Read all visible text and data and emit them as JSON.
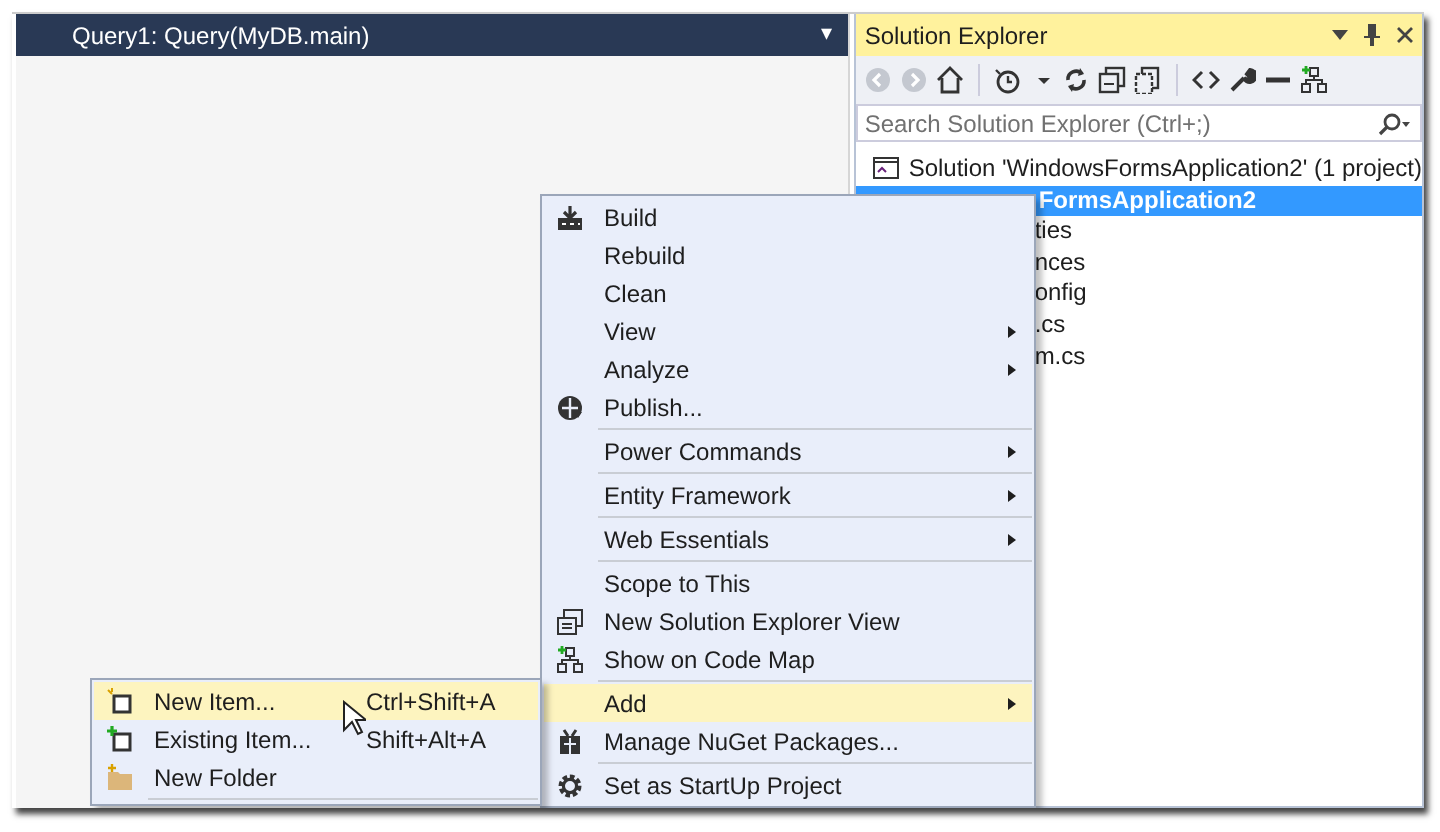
{
  "document_tab": {
    "title": "Query1: Query(MyDB.main)",
    "dropdown": "▾"
  },
  "solution_explorer": {
    "title": "Solution Explorer",
    "search": {
      "placeholder": "Search Solution Explorer (Ctrl+;)"
    },
    "tree": [
      {
        "label": "Solution 'WindowsFormsApplication2' (1 project)",
        "selected": false,
        "children": [
          {
            "label": "FormsApplication2",
            "selected": true,
            "children": [
              {
                "label": "ties",
                "selected": false
              },
              {
                "label": "nces",
                "selected": false
              },
              {
                "label": "onfig",
                "selected": false
              },
              {
                "label": ".cs",
                "selected": false
              },
              {
                "label": "m.cs",
                "selected": false
              }
            ]
          }
        ]
      }
    ]
  },
  "context_menu": {
    "items": [
      {
        "kind": "item",
        "label": "Build",
        "submenu": false,
        "selected": false
      },
      {
        "kind": "item",
        "label": "Rebuild",
        "submenu": false,
        "selected": false
      },
      {
        "kind": "item",
        "label": "Clean",
        "submenu": false,
        "selected": false
      },
      {
        "kind": "item",
        "label": "View",
        "submenu": true,
        "selected": false
      },
      {
        "kind": "item",
        "label": "Analyze",
        "submenu": true,
        "selected": false
      },
      {
        "kind": "item",
        "label": "Publish...",
        "submenu": false,
        "selected": false
      },
      {
        "kind": "separator"
      },
      {
        "kind": "item",
        "label": "Power Commands",
        "submenu": true,
        "selected": false
      },
      {
        "kind": "separator"
      },
      {
        "kind": "item",
        "label": "Entity Framework",
        "submenu": true,
        "selected": false
      },
      {
        "kind": "separator"
      },
      {
        "kind": "item",
        "label": "Web Essentials",
        "submenu": true,
        "selected": false
      },
      {
        "kind": "separator"
      },
      {
        "kind": "item",
        "label": "Scope to This",
        "submenu": false,
        "selected": false
      },
      {
        "kind": "item",
        "label": "New Solution Explorer View",
        "submenu": false,
        "selected": false
      },
      {
        "kind": "item",
        "label": "Show on Code Map",
        "submenu": false,
        "selected": false
      },
      {
        "kind": "separator"
      },
      {
        "kind": "item",
        "label": "Add",
        "submenu": true,
        "selected": true
      },
      {
        "kind": "item",
        "label": "Manage NuGet Packages...",
        "submenu": false,
        "selected": false
      },
      {
        "kind": "separator"
      },
      {
        "kind": "item",
        "label": "Set as StartUp Project",
        "submenu": false,
        "selected": false
      }
    ]
  },
  "add_submenu": {
    "items": [
      {
        "kind": "item",
        "label": "New Item...",
        "shortcut": "Ctrl+Shift+A",
        "selected": true
      },
      {
        "kind": "item",
        "label": "Existing Item...",
        "shortcut": "Shift+Alt+A",
        "selected": false
      },
      {
        "kind": "item",
        "label": "New Folder",
        "selected": false
      },
      {
        "kind": "separator"
      }
    ]
  }
}
